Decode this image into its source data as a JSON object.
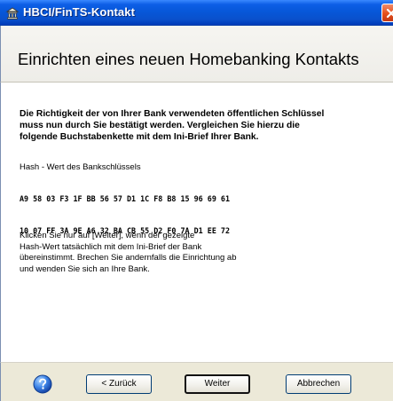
{
  "window": {
    "title": "HBCI/FinTS-Kontakt",
    "icon_name": "bank-icon",
    "close_icon_name": "close-icon",
    "title_bar_color": "#0757d8",
    "close_button_color": "#e6501b"
  },
  "header": {
    "title": "Einrichten eines neuen Homebanking Kontakts"
  },
  "content": {
    "intro_lines": [
      "Die Richtigkeit der von Ihrer Bank verwendeten öffentlichen Schlüssel",
      "muss nun durch Sie bestätigt werden. Vergleichen Sie hierzu die",
      "folgende Buchstabenkette mit dem Ini-Brief Ihrer Bank."
    ],
    "hash_label": "Hash - Wert des Bankschlüssels",
    "hash_lines": [
      "A9 58 03 F3 1F BB 56 57 D1 1C F8 B8 15 96 69 61",
      "10 07 FF 3A 9E A6 32 BA CB 55 D2 F0 7A D1 EE 72"
    ],
    "instruction_lines": [
      "Klicken Sie nur auf [Weiter], wenn der gezeigte",
      "Hash-Wert tatsächlich mit dem Ini-Brief der Bank",
      "übereinstimmt. Brechen Sie andernfalls die Einrichtung ab",
      "und wenden Sie sich an Ihre Bank."
    ]
  },
  "footer": {
    "help_icon": "help-icon",
    "buttons": {
      "back": "< Zurück",
      "next": "Weiter",
      "cancel": "Abbrechen"
    }
  }
}
